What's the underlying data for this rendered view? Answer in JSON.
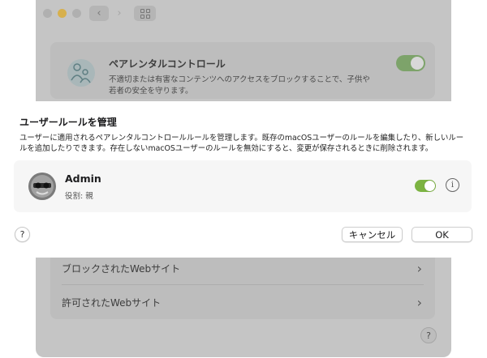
{
  "background_window": {
    "parental_controls": {
      "title": "ペアレンタルコントロール",
      "description": "不適切または有害なコンテンツへのアクセスをブロックすることで、子供や若者の安全を守ります。",
      "enabled": true
    },
    "list": [
      {
        "label": "ブロックされたWebサイト"
      },
      {
        "label": "許可されたWebサイト"
      }
    ],
    "help_label": "?"
  },
  "sheet": {
    "title": "ユーザールールを管理",
    "description": "ユーザーに適用されるペアレンタルコントロールルールを管理します。既存のmacOSユーザーのルールを編集したり、新しいルールを追加したりできます。存在しないmacOSユーザーのルールを無効にすると、変更が保存されるときに削除されます。",
    "user": {
      "name": "Admin",
      "role": "役割: 親",
      "enabled": true,
      "info_icon": "info-circle-icon"
    },
    "help_label": "?",
    "cancel_label": "キャンセル",
    "ok_label": "OK"
  },
  "colors": {
    "toggle_on": "#7cb342",
    "dim_background": "#c5c5c5"
  }
}
